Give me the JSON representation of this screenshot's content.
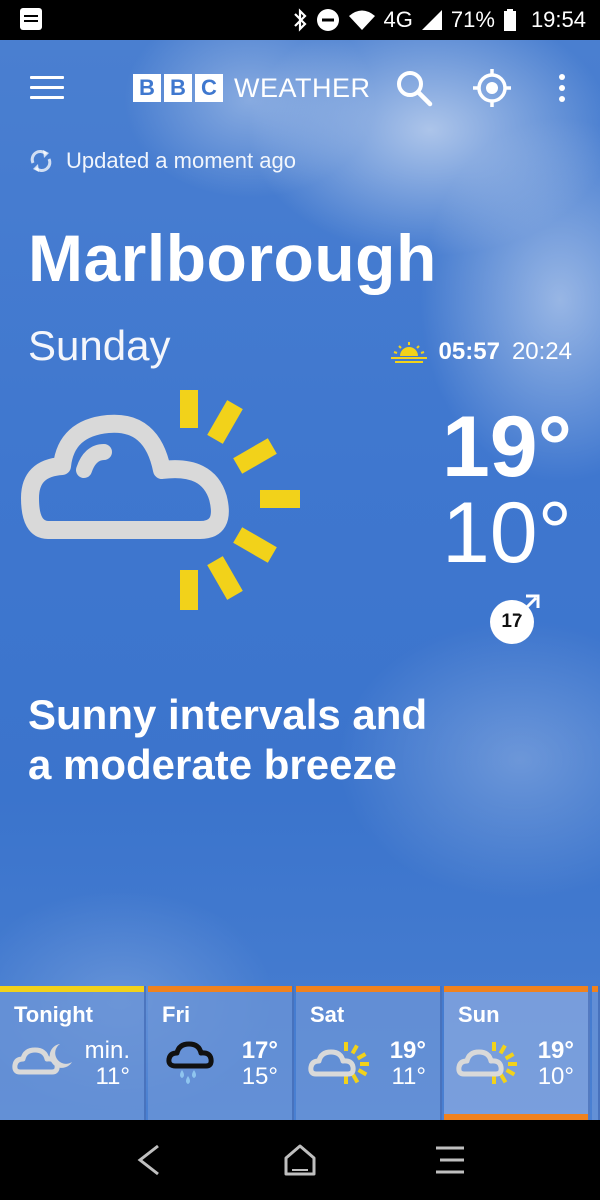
{
  "status_bar": {
    "network": "4G",
    "battery": "71%",
    "time": "19:54"
  },
  "app_bar": {
    "logo_letters": [
      "B",
      "B",
      "C"
    ],
    "logo_word": "WEATHER"
  },
  "updated_text": "Updated a moment ago",
  "location": "Marlborough",
  "day": "Sunday",
  "sunrise": "05:57",
  "sunset": "20:24",
  "temp_max": "19°",
  "temp_min": "10°",
  "wind_speed": "17",
  "summary_line1": "Sunny intervals and",
  "summary_line2": "a moderate breeze",
  "forecast": [
    {
      "label": "Tonight",
      "hi": "min.",
      "lo": "11°",
      "bar_color": "#f2d21a",
      "icon": "cloud-moon-icon"
    },
    {
      "label": "Fri",
      "hi": "17°",
      "lo": "15°",
      "bar_color": "#f0821e",
      "icon": "rain-cloud-icon"
    },
    {
      "label": "Sat",
      "hi": "19°",
      "lo": "11°",
      "bar_color": "#f0821e",
      "icon": "sun-cloud-icon"
    },
    {
      "label": "Sun",
      "hi": "19°",
      "lo": "10°",
      "bar_color": "#f0821e",
      "icon": "sun-cloud-icon",
      "selected": true
    }
  ],
  "colors": {
    "sun_yellow": "#f2d21a",
    "sunny_orange": "#f0821e",
    "sky_blue": "#3f78cf"
  }
}
